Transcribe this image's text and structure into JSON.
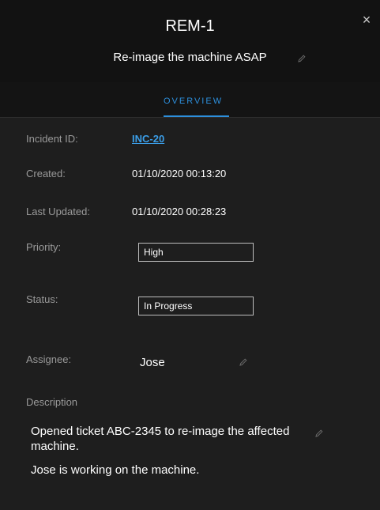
{
  "header": {
    "title": "REM-1",
    "subtitle": "Re-image the machine ASAP",
    "close_symbol": "×"
  },
  "tabs": [
    {
      "label": "OVERVIEW",
      "active": true
    }
  ],
  "fields": {
    "incident_id": {
      "label": "Incident ID:",
      "value": "INC-20"
    },
    "created": {
      "label": "Created:",
      "value": "01/10/2020 00:13:20"
    },
    "last_updated": {
      "label": "Last Updated:",
      "value": "01/10/2020 00:28:23"
    },
    "priority": {
      "label": "Priority:",
      "value": "High"
    },
    "status": {
      "label": "Status:",
      "value": "In Progress"
    },
    "assignee": {
      "label": "Assignee:",
      "value": "Jose"
    }
  },
  "description": {
    "label": "Description",
    "paragraphs": [
      "Opened ticket ABC-2345 to re-image the affected machine.",
      "Jose is working on the machine."
    ]
  },
  "icons": {
    "close": "close-icon",
    "edit": "pencil-icon"
  },
  "colors": {
    "accent": "#2d8fdc",
    "link": "#3b9ee8",
    "header_bg": "#121212",
    "body_bg": "#1e1e1e",
    "label": "#9a9a9a"
  }
}
